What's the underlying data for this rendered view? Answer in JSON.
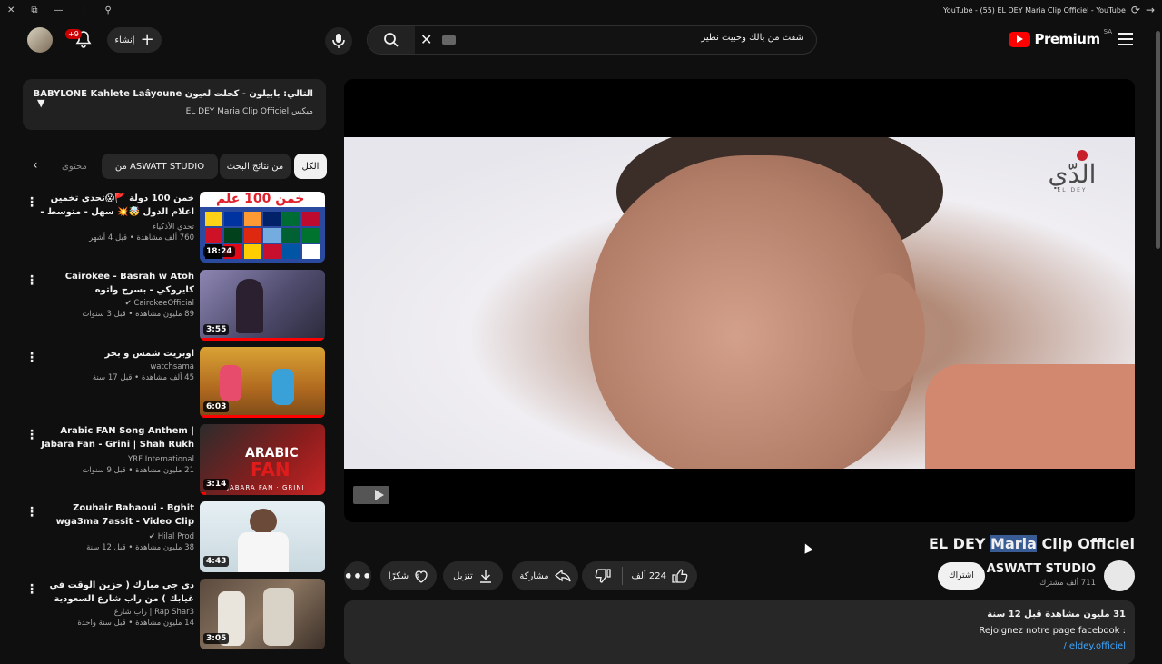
{
  "titlebar": {
    "title": "YouTube - (55) EL DEY Maria Clip Officiel - YouTube",
    "left_icons": [
      "close-icon",
      "pin-icon",
      "minimize-icon",
      "more-icon",
      "search-icon"
    ],
    "right_icons": [
      "reload-icon",
      "forward-icon"
    ]
  },
  "masthead": {
    "notifications_badge": "+9",
    "create_label": "إنشاء",
    "search_value": "شفت من بالك وحبيت نطير",
    "logo_word": "Premium",
    "logo_region": "SA"
  },
  "playlist": {
    "title": "التالي: بابيلون - كحلت لعيون BABYLONE Kahlete Laâyoune",
    "mix_label": "ميكس",
    "subtitle": "EL DEY Maria Clip Officiel"
  },
  "chips": [
    {
      "label": "الكل",
      "active": true
    },
    {
      "label": "من نتائج البحث",
      "active": false
    },
    {
      "label": "من ASWATT STUDIO",
      "active": false
    },
    {
      "label": "محتوى",
      "active": false
    }
  ],
  "recommendations": [
    {
      "title": "خمن 100 دولة 🚩😱تحدي تخمين اعلام الدول 🤯💥 سهل - متوسط - صعب!!",
      "channel": "تحدي الأذكياء",
      "views": "760 ألف مشاهدة • قبل 4 أشهر",
      "duration": "18:24",
      "verified": false,
      "progress": 0
    },
    {
      "title": "Cairokee - Basrah w Atoh كايروكي - بسرح واتوه",
      "channel": "CairokeeOfficial",
      "views": "89 مليون مشاهدة • قبل 3 سنوات",
      "duration": "3:55",
      "verified": true,
      "progress": 1.0
    },
    {
      "title": "اوبريت شمس و بحر",
      "channel": "watchsama",
      "views": "45 ألف مشاهدة • قبل 17 سنة",
      "duration": "6:03",
      "verified": false,
      "progress": 1.0
    },
    {
      "title": "Arabic FAN Song Anthem | Jabara Fan - Grini | Shah Rukh ...",
      "channel": "YRF International",
      "views": "21 مليون مشاهدة • قبل 9 سنوات",
      "duration": "3:14",
      "verified": false,
      "progress": 0.05
    },
    {
      "title": "Zouhair Bahaoui - Bghit wga3ma 7assit - Video Clip Officiel",
      "channel": "Hilal Prod",
      "views": "38 مليون مشاهدة • قبل 12 سنة",
      "duration": "4:43",
      "verified": true,
      "progress": 0
    },
    {
      "title": "دي جي مبارك ( حزين الوقت في غيابك ) من راب شارع السعودية",
      "channel": "Rap Shar3 | راب شارع",
      "views": "14 مليون مشاهدة • قبل سنة واحدة",
      "duration": "3:05",
      "verified": false,
      "progress": 0
    }
  ],
  "video": {
    "title_pre": "EL DEY ",
    "title_hl": "Maria",
    "title_post": " Clip Officiel",
    "watermark_ar": "الدّي",
    "watermark_lat": "EL DEY",
    "channel": "ASWATT STUDIO",
    "subscribers": "711 ألف مشترك",
    "subscribe_label": "اشتراك",
    "likes": "224 ألف",
    "share_label": "مشاركة",
    "download_label": "تنزيل",
    "thanks_label": "شكرًا",
    "views_line": "31 مليون مشاهدة  قبل 12 سنة",
    "desc_line": "Rejoignez notre page facebook :",
    "desc_link": "/ eldey.officiel"
  },
  "colors": {
    "background": "#0f0f0f",
    "chip": "#272727",
    "accent_red": "#ff0000",
    "link": "#3ea6ff"
  }
}
